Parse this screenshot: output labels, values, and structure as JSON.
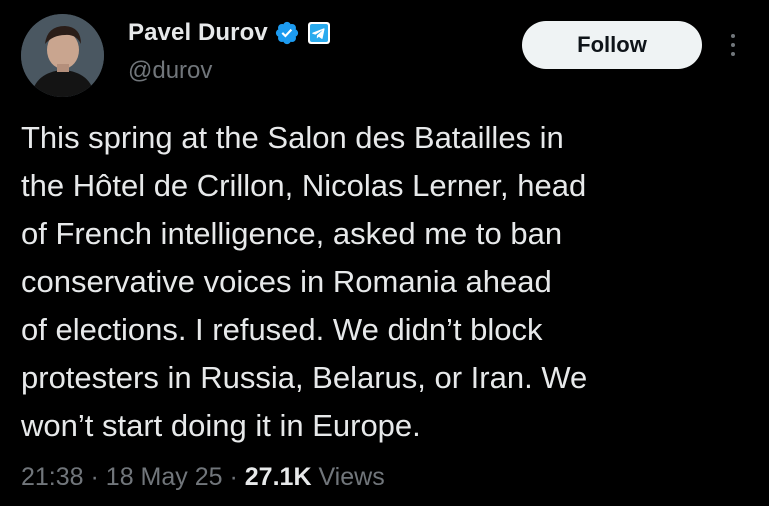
{
  "author": {
    "display_name": "Pavel Durov",
    "handle": "@durov",
    "verified_color": "#1d9bf0",
    "affiliate_badge_icon": "telegram-icon",
    "avatar_icon": "profile-photo"
  },
  "header": {
    "follow_label": "Follow",
    "more_icon": "more-vertical-icon"
  },
  "tweet": {
    "lines": [
      "This spring at the Salon des Batailles in",
      "the Hôtel de Crillon, Nicolas Lerner, head",
      "of French intelligence, asked me to ban",
      "conservative voices in Romania ahead",
      "of elections. I refused. We didn’t block",
      "protesters in Russia, Belarus, or Iran. We",
      "won’t start doing it in Europe."
    ]
  },
  "meta": {
    "time": "21:38",
    "separator": "·",
    "date": "18 May 25",
    "views_count": "27.1K",
    "views_label": "Views"
  },
  "colors": {
    "background": "#000000",
    "text_primary": "#e7e9ea",
    "text_secondary": "#71767b",
    "follow_bg": "#eff3f4",
    "follow_text": "#0f1419"
  }
}
